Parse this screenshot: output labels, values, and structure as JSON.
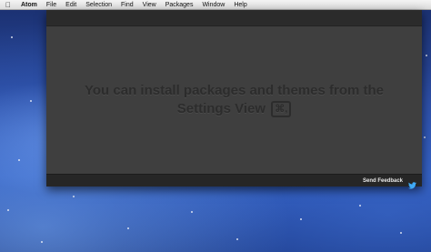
{
  "menubar": {
    "apple_icon": "apple-logo-icon",
    "items": [
      "Atom",
      "File",
      "Edit",
      "Selection",
      "Find",
      "View",
      "Packages",
      "Window",
      "Help"
    ]
  },
  "editor": {
    "message": "You can install packages and themes from the Settings View",
    "keybinding": "⌘,"
  },
  "statusbar": {
    "feedback_label": "Send Feedback",
    "feedback_icon": "twitter-bird-icon"
  },
  "colors": {
    "window_bg": "#3f3f3f",
    "titlebar_bg": "#2b2b2b",
    "statusbar_bg": "#262626",
    "feedback_icon": "#3fa9f5"
  }
}
